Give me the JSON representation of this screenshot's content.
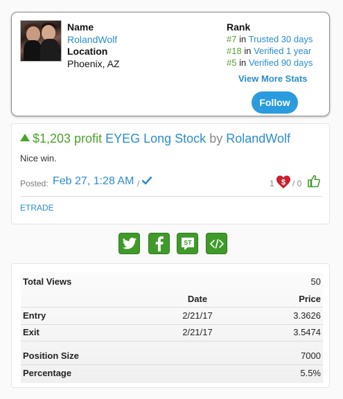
{
  "profile": {
    "name_label": "Name",
    "name": "RolandWolf",
    "location_label": "Location",
    "location": "Phoenix, AZ",
    "rank_label": "Rank",
    "ranks": [
      {
        "num": "#7",
        "in": "in",
        "text": "Trusted 30 days"
      },
      {
        "num": "#18",
        "in": "in",
        "text": "Verified 1 year"
      },
      {
        "num": "#5",
        "in": "in",
        "text": "Verified 90 days"
      }
    ],
    "view_more": "View More Stats",
    "follow": "Follow"
  },
  "trade": {
    "profit": "$1,203 profit",
    "ticker": "EYEG Long Stock",
    "by": "by",
    "author": "RolandWolf",
    "comment": "Nice win.",
    "posted_label": "Posted:",
    "posted_date": "Feb 27, 1:28 AM",
    "slash": "/",
    "downvotes": "1",
    "upvotes_sep": "/ 0",
    "broker": "ETRADE"
  },
  "share": {
    "buttons": [
      "twitter-icon",
      "facebook-icon",
      "stocktwits-icon",
      "embed-code-icon"
    ],
    "color": "#3f9a2a"
  },
  "stats": {
    "total_views_label": "Total Views",
    "total_views": "50",
    "col_date": "Date",
    "col_price": "Price",
    "entry_label": "Entry",
    "entry_date": "2/21/17",
    "entry_price": "3.3626",
    "exit_label": "Exit",
    "exit_date": "2/21/17",
    "exit_price": "3.5474",
    "position_size_label": "Position Size",
    "position_size": "7000",
    "percentage_label": "Percentage",
    "percentage": "5.5%"
  },
  "colors": {
    "accent_blue": "#2a8ccf",
    "profit_green": "#4aa32a",
    "follow_button": "#2b9be0"
  }
}
